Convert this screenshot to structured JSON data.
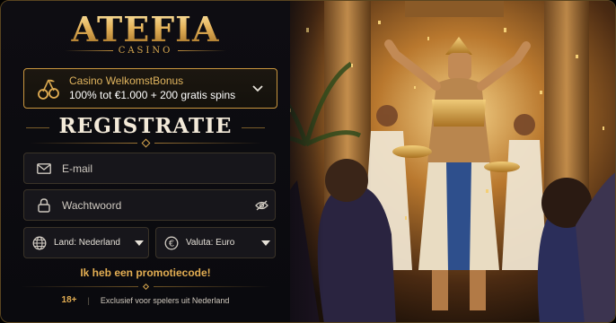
{
  "brand": {
    "name": "ATEFIA",
    "subtitle": "CASINO"
  },
  "bonus": {
    "title": "Casino WelkomstBonus",
    "description": "100% tot €1.000 + 200 gratis spins",
    "icon": "cherry-icon"
  },
  "form": {
    "title": "REGISTRATIE",
    "email_placeholder": "E-mail",
    "password_placeholder": "Wachtwoord",
    "country_label": "Land: Nederland",
    "currency_label": "Valuta: Euro",
    "promo_link": "Ik heb een promotiecode!"
  },
  "footer": {
    "age": "18+",
    "notice": "Exclusief voor spelers uit Nederland"
  },
  "colors": {
    "accent_gold": "#e2ad52",
    "background": "#0c0b10",
    "field_background": "#17161b"
  }
}
